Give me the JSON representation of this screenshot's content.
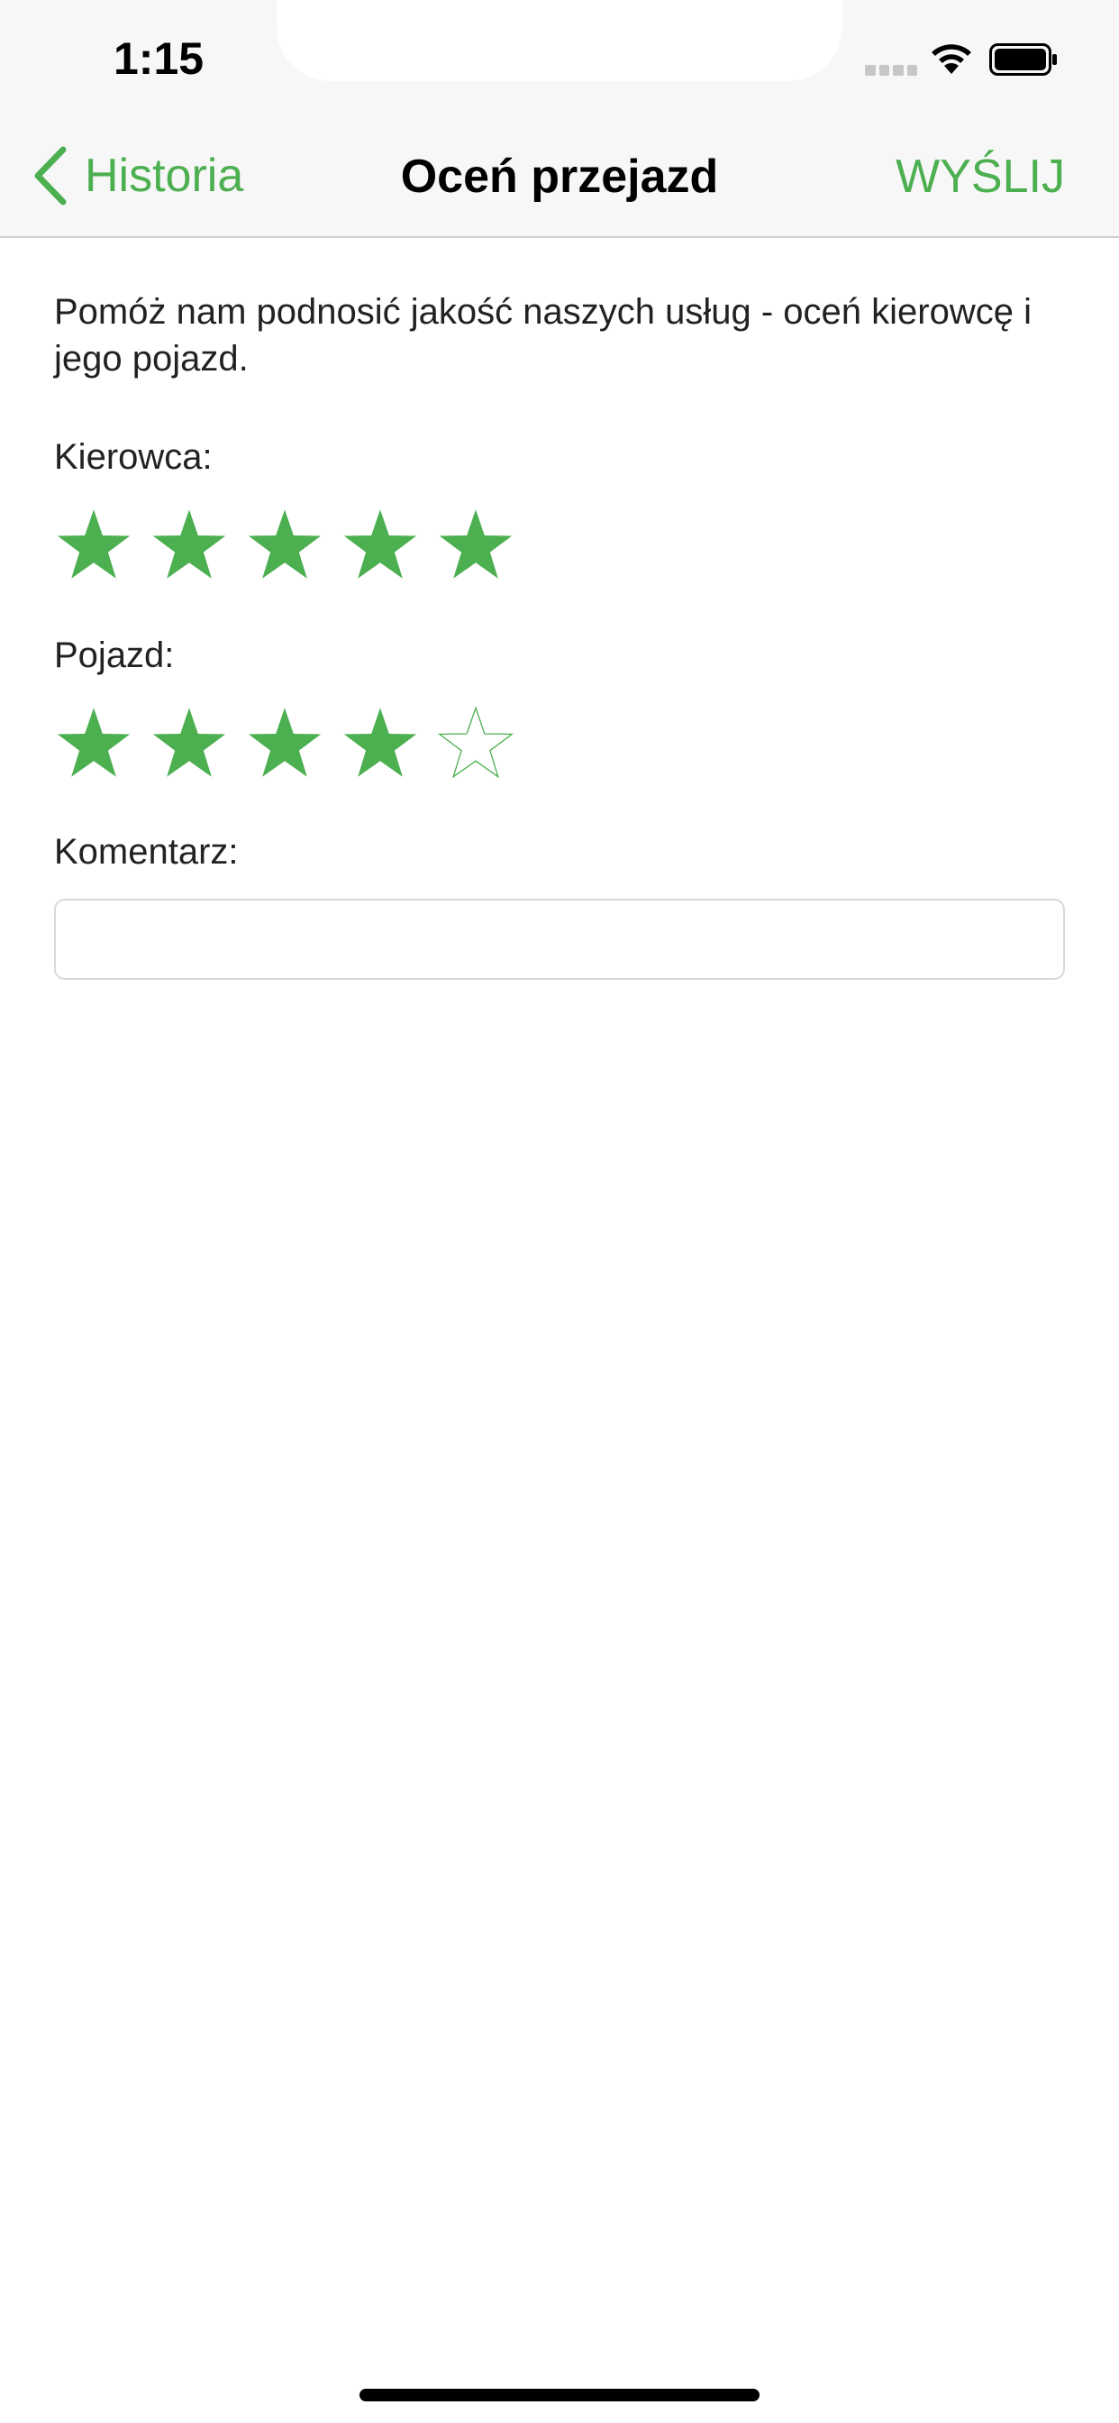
{
  "status_bar": {
    "time": "1:15"
  },
  "nav": {
    "back_label": "Historia",
    "title": "Oceń przejazd",
    "send_label": "WYŚLIJ"
  },
  "content": {
    "intro": "Pomóż nam podnosić jakość naszych usług - oceń kierowcę i jego pojazd.",
    "driver_label": "Kierowca:",
    "driver_rating": 5,
    "vehicle_label": "Pojazd:",
    "vehicle_rating": 4,
    "max_rating": 5,
    "comment_label": "Komentarz:",
    "comment_value": ""
  },
  "colors": {
    "accent": "#4caf50",
    "nav_bg": "#f7f7f7",
    "text": "#222222"
  },
  "icons": {
    "back": "chevron-left-icon",
    "star_filled": "star-filled-icon",
    "star_empty": "star-outline-icon"
  }
}
